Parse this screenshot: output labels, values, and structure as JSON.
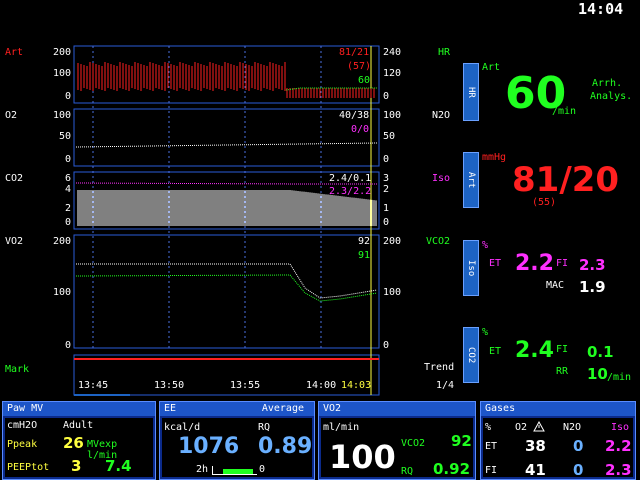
{
  "clock": "14:04",
  "left_labels": {
    "art": "Art",
    "o2": "O2",
    "co2": "CO2",
    "vo2": "VO2",
    "mark": "Mark"
  },
  "art_wave": {
    "scale_left": [
      "200",
      "100",
      "0"
    ],
    "scale_right": [
      "240",
      "120",
      "0"
    ],
    "value": "81/21",
    "mean": "(57)",
    "hr": "60"
  },
  "o2_wave": {
    "scale_left": [
      "100",
      "50",
      "0"
    ],
    "scale_right": [
      "100",
      "50",
      "0"
    ],
    "value": "40/38",
    "value2": "0/0"
  },
  "co2_wave": {
    "scale_left": [
      "6",
      "4",
      "2",
      "0"
    ],
    "scale_right": [
      "3",
      "2",
      "1",
      "0"
    ],
    "value": "2.4/0.1",
    "value2": "2.3/2.2"
  },
  "vo2_wave": {
    "scale_left": [
      "200",
      "100",
      "0"
    ],
    "scale_right": [
      "200",
      "100",
      "0"
    ],
    "value": "92",
    "value2": "91"
  },
  "right_labels": {
    "hr": "HR",
    "n2o": "N2O",
    "iso": "Iso",
    "vco2": "VCO2",
    "trend": "Trend",
    "page": "1/4"
  },
  "time_axis": [
    "13:45",
    "13:50",
    "13:55",
    "14:00",
    "14:03"
  ],
  "numerics": {
    "hr": {
      "btn": "HR",
      "source": "Art",
      "value": "60",
      "unit": "/min",
      "note1": "Arrh.",
      "note2": "Analys."
    },
    "art": {
      "btn": "Art",
      "unit": "mmHg",
      "value": "81/20",
      "mean": "(55)"
    },
    "iso": {
      "btn": "Iso",
      "pct": "%",
      "et_label": "ET",
      "et": "2.2",
      "fi_label": "FI",
      "fi": "2.3",
      "mac_label": "MAC",
      "mac": "1.9"
    },
    "co2": {
      "btn": "CO2",
      "pct": "%",
      "et_label": "ET",
      "et": "2.4",
      "fi_label": "FI",
      "fi": "0.1",
      "rr_label": "RR",
      "rr": "10",
      "rr_unit": "/min"
    }
  },
  "bottom": {
    "paw": {
      "title": "Paw MV",
      "unit": "cmH2O",
      "mode": "Adult",
      "ppeak_label": "Ppeak",
      "ppeak": "26",
      "mvexp_label": "MVexp l/min",
      "peeptot_label": "PEEPtot",
      "peeptot": "3",
      "mvexp": "7.4"
    },
    "ee": {
      "title": "EE",
      "avg": "Average",
      "kcal": "kcal/d",
      "rq_label": "RQ",
      "ee_value": "1076",
      "rq_value": "0.89",
      "period": "2h",
      "period_end": "0"
    },
    "vo2": {
      "title": "VO2",
      "unit": "ml/min",
      "value": "100",
      "vco2_label": "VCO2",
      "vco2": "92",
      "rq_label": "RQ",
      "rq": "0.92"
    },
    "gases": {
      "title": "Gases",
      "pct": "%",
      "o2": "O2",
      "n2o": "N2O",
      "iso": "Iso",
      "et_label": "ET",
      "fi_label": "FI",
      "et_o2": "38",
      "et_n2o": "0",
      "et_iso": "2.2",
      "fi_o2": "41",
      "fi_n2o": "0",
      "fi_iso": "2.3"
    }
  },
  "colors": {
    "red": "#ff2020",
    "green": "#20ff20",
    "magenta": "#ff30ff",
    "blue": "#1d63c4"
  }
}
